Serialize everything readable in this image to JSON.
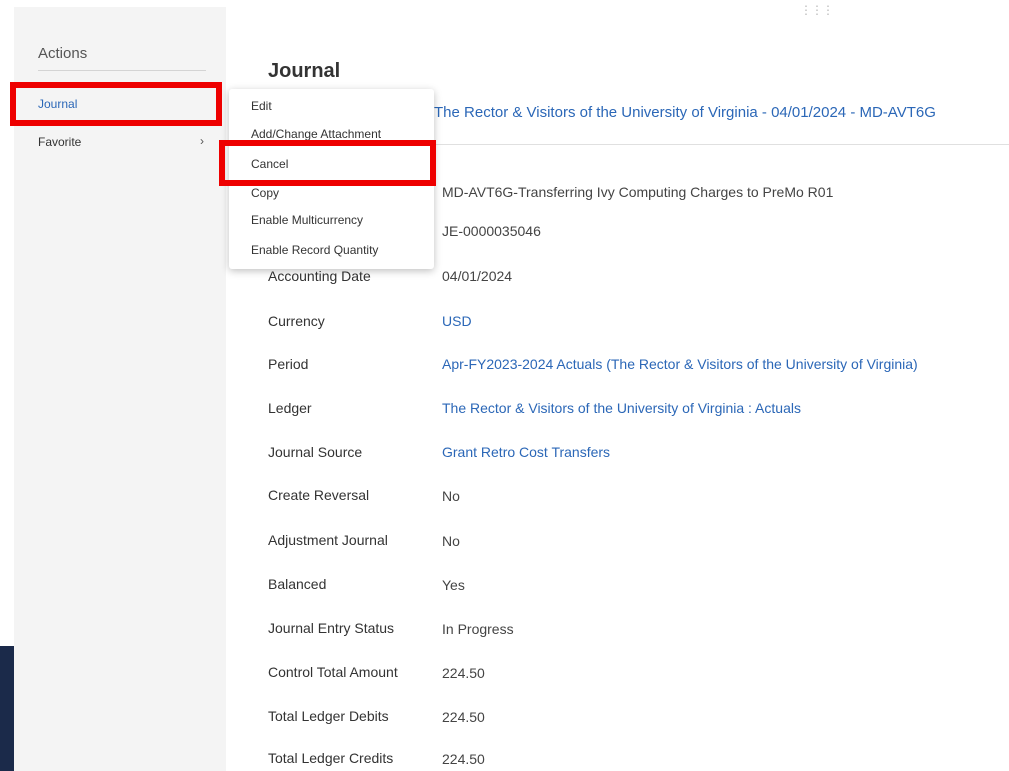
{
  "sidebar": {
    "title": "Actions",
    "items": [
      {
        "label": "Journal"
      },
      {
        "label": "Favorite"
      }
    ]
  },
  "menu": {
    "items": [
      {
        "label": "Edit"
      },
      {
        "label": "Add/Change Attachment"
      },
      {
        "label": "Cancel"
      },
      {
        "label": "Copy"
      },
      {
        "label": "Enable Multicurrency"
      },
      {
        "label": "Enable Record Quantity"
      }
    ]
  },
  "main": {
    "heading": "Journal",
    "title_link": "The Rector & Visitors of the University of Virginia - 04/01/2024 - MD-AVT6G",
    "description": "MD-AVT6G-Transferring Ivy Computing Charges to PreMo R01",
    "journal_number": "JE-0000035046",
    "fields": [
      {
        "label": "Accounting Date",
        "value": "04/01/2024"
      },
      {
        "label": "Currency",
        "value": "USD"
      },
      {
        "label": "Period",
        "value": "Apr-FY2023-2024 Actuals (The Rector & Visitors of the University of Virginia)"
      },
      {
        "label": "Ledger",
        "value": "The Rector & Visitors of the University of Virginia : Actuals"
      },
      {
        "label": "Journal Source",
        "value": "Grant Retro Cost Transfers"
      },
      {
        "label": "Create Reversal",
        "value": "No"
      },
      {
        "label": "Adjustment Journal",
        "value": "No"
      },
      {
        "label": "Balanced",
        "value": "Yes"
      },
      {
        "label": "Journal Entry Status",
        "value": "In Progress"
      },
      {
        "label": "Control Total Amount",
        "value": "224.50"
      },
      {
        "label": "Total Ledger Debits",
        "value": "224.50"
      },
      {
        "label": "Total Ledger Credits",
        "value": "224.50"
      }
    ]
  },
  "colors": {
    "link": "#2b67b7",
    "highlight": "#ee0000",
    "panel": "#f4f4f4"
  }
}
